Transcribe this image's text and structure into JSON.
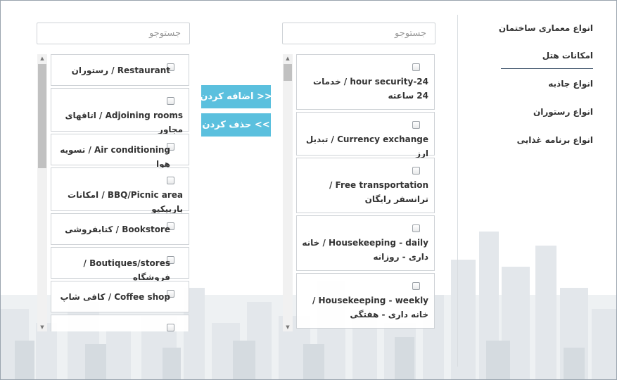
{
  "sidebar": {
    "items": [
      {
        "label": "انواع معماری ساختمان"
      },
      {
        "label": "امکانات هتل",
        "active": true
      },
      {
        "label": "انواع جاذبه"
      },
      {
        "label": "انواع رستوران"
      },
      {
        "label": "انواع برنامه غذایی"
      }
    ]
  },
  "available": {
    "search_placeholder": "جستوجو",
    "items": [
      {
        "label": "24-hour security / خدمات 24 ساعته",
        "checked": false
      },
      {
        "label": "Currency exchange / تبدیل ارز",
        "checked": false
      },
      {
        "label": "Free transportation / ترانسفر رایگان",
        "checked": false
      },
      {
        "label": "Housekeeping - daily / خانه داری - روزانه",
        "checked": false
      },
      {
        "label": "Housekeeping - weekly / خانه داری - هفتگی",
        "checked": false
      }
    ]
  },
  "selected": {
    "search_placeholder": "جستوجو",
    "items": [
      {
        "label": "Restaurant / رستوران",
        "checked": false
      },
      {
        "label": "Adjoining rooms / اتاقهای مجاور",
        "checked": false
      },
      {
        "label": "Air conditioning / تسویه هوا",
        "checked": false
      },
      {
        "label": "BBQ/Picnic area / امکانات باربیکیو",
        "checked": false
      },
      {
        "label": "Bookstore / کتابفروشی",
        "checked": false
      },
      {
        "label": "Boutiques/stores / فروشگاه",
        "checked": false
      },
      {
        "label": "Coffee shop / کافی شاپ",
        "checked": false
      },
      {
        "label": "",
        "checked": false
      }
    ]
  },
  "actions": {
    "add_label": "اضافه کردن >>",
    "remove_label": "حذف کردن <<"
  },
  "colors": {
    "button": "#5bc0de",
    "active_underline": "#3b5068",
    "skyline": "#dfe4e8"
  }
}
